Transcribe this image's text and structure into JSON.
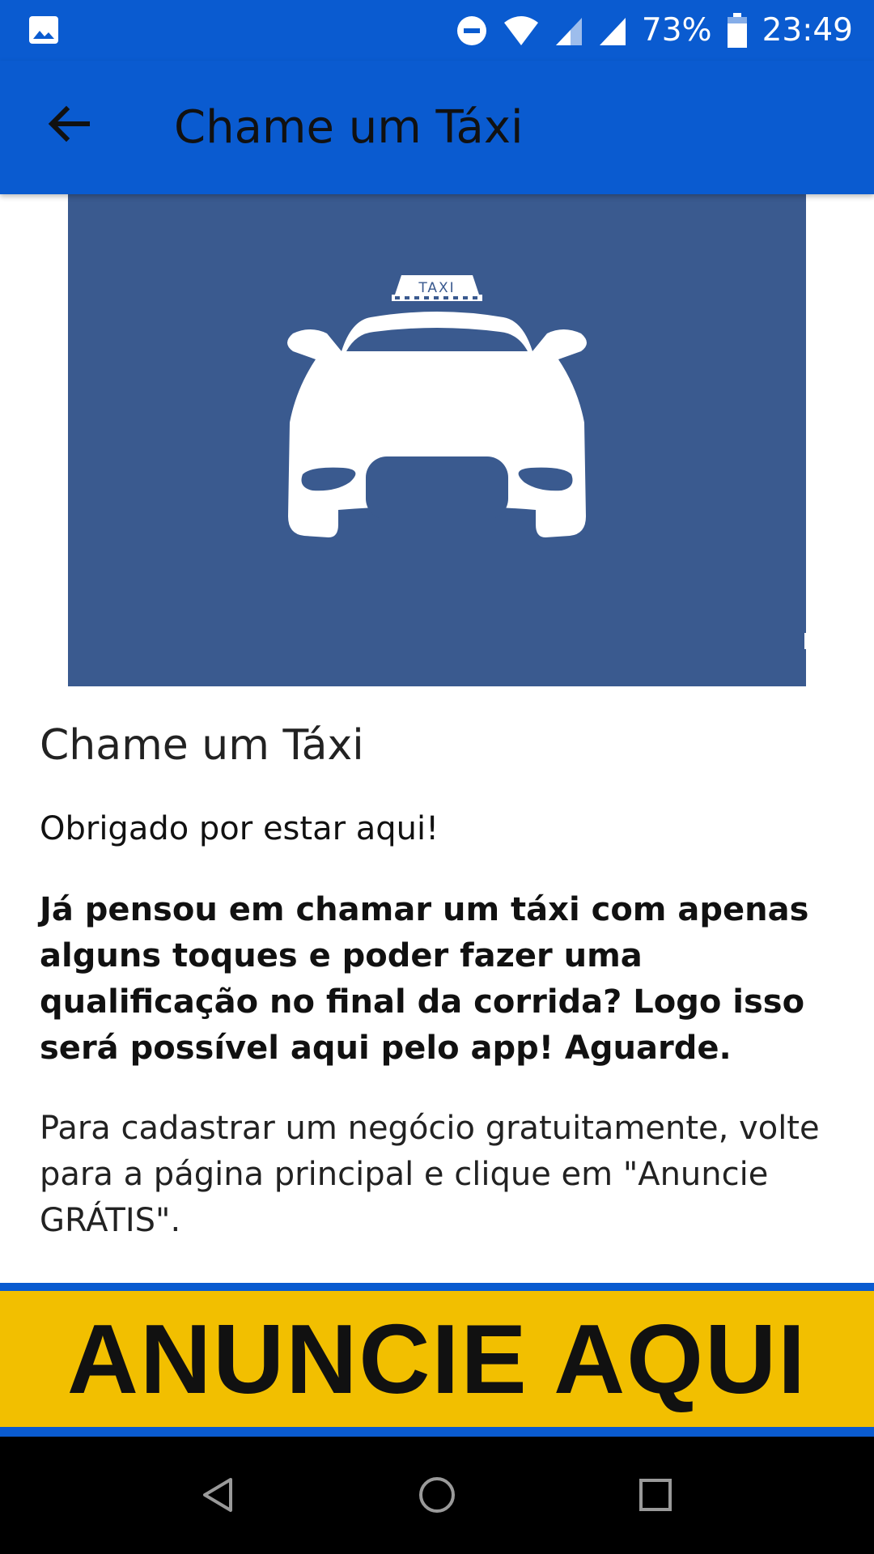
{
  "status_bar": {
    "battery_percent": "73%",
    "time": "23:49",
    "icons": [
      "image-icon",
      "do-not-disturb-icon",
      "wifi-icon",
      "signal-icon",
      "signal-icon",
      "battery-icon"
    ]
  },
  "app_bar": {
    "title": "Chame um Táxi",
    "back_icon": "arrow-back-icon",
    "color": "#0a5bd0"
  },
  "hero": {
    "taxi_sign": "TAXI",
    "background_color": "#3a5a8f",
    "expand_icon": "expand-icon"
  },
  "content": {
    "heading": "Chame um Táxi",
    "greeting": "Obrigado por estar aqui!",
    "bold_paragraph": "Já pensou em chamar um táxi com apenas alguns toques e poder fazer uma qualificação no final da corrida? Logo isso será possível aqui pelo app! Aguarde.",
    "info_paragraph": "Para cadastrar um negócio gratuitamente, volte para a página principal e clique em \"Anuncie GRÁTIS\"."
  },
  "banner": {
    "text": "ANUNCIE AQUI",
    "background_color": "#f2bf00"
  },
  "nav_bar": {
    "icons": [
      "back-triangle-icon",
      "home-circle-icon",
      "recents-square-icon"
    ]
  }
}
